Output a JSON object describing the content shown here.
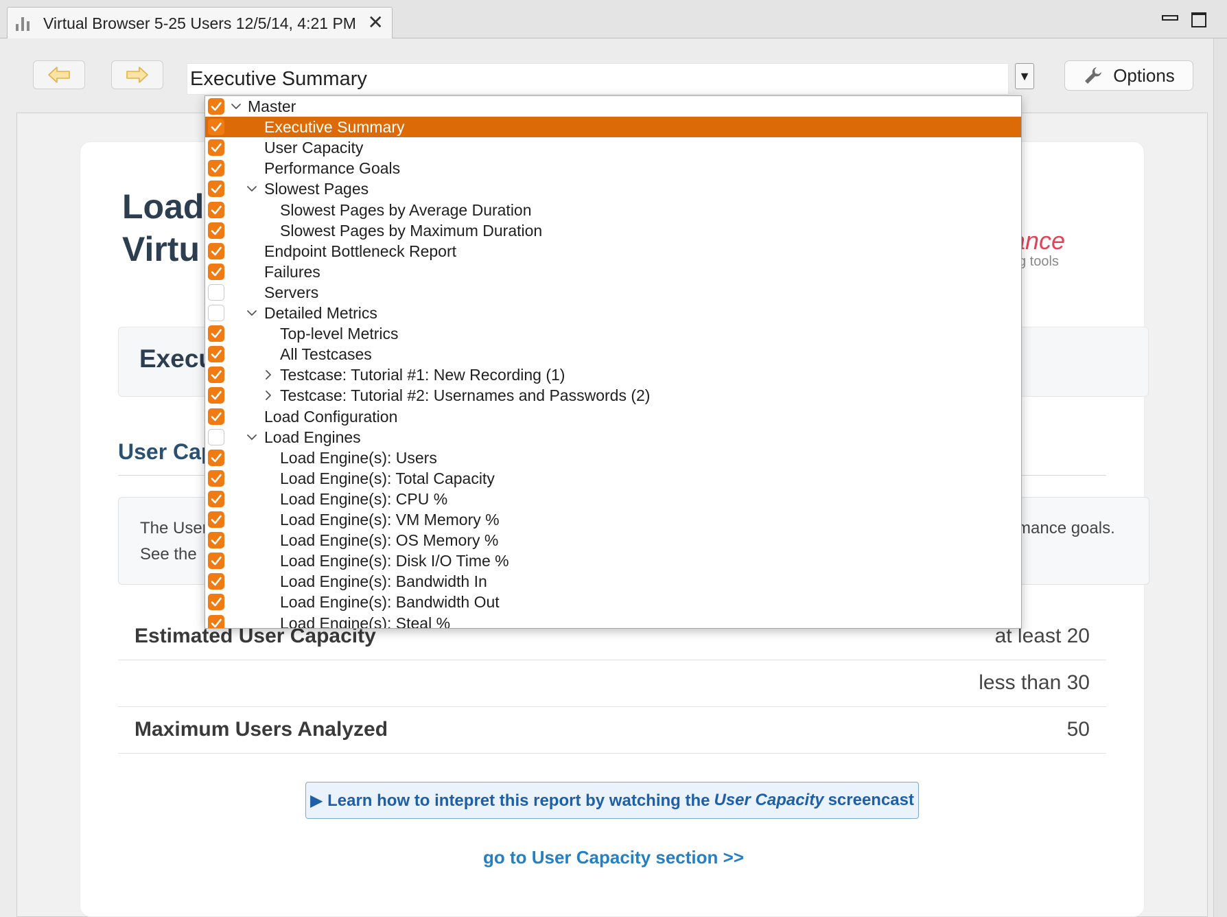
{
  "tab": {
    "title": "Virtual Browser 5-25 Users 12/5/14, 4:21 PM",
    "close_symbol": "✕",
    "icon": "bar-chart-icon"
  },
  "toolbar": {
    "back_icon": "back-arrow-icon",
    "forward_icon": "forward-arrow-icon",
    "report_select": "Executive Summary",
    "dropdown_symbol": "▼",
    "options_label": "Options",
    "options_icon": "wrench-icon"
  },
  "report": {
    "title_line1": "Load",
    "title_line2": "Virtu",
    "brand_partial": "ance",
    "brand_sub_partial": "g tools",
    "section_header": "Execu",
    "subsection_title": "User Cap",
    "info_line1_left": "The User",
    "info_line2_left": "See the",
    "info_line1_right": "mance goals.",
    "table": [
      {
        "label": "Estimated User Capacity",
        "value": "at least 20"
      },
      {
        "label": "",
        "value": "less than 30"
      },
      {
        "label": "Maximum Users Analyzed",
        "value": "50"
      }
    ],
    "learn_prefix": "▶ Learn how to intepret this report by watching the",
    "learn_emph": "User Capacity",
    "learn_suffix": "screencast",
    "goto_link": "go to User Capacity section >>"
  },
  "colors": {
    "accent_orange": "#f07b12",
    "selected_row": "#dc6b07",
    "heading": "#2c3e50",
    "link": "#2480c3"
  },
  "dropdown": {
    "items": [
      {
        "label": "Master",
        "level": 0,
        "checked": true,
        "expander": "expanded",
        "selected": false
      },
      {
        "label": "Executive Summary",
        "level": 1,
        "checked": true,
        "expander": "none",
        "selected": true
      },
      {
        "label": "User Capacity",
        "level": 1,
        "checked": true,
        "expander": "none",
        "selected": false
      },
      {
        "label": "Performance Goals",
        "level": 1,
        "checked": true,
        "expander": "none",
        "selected": false
      },
      {
        "label": "Slowest Pages",
        "level": 1,
        "checked": true,
        "expander": "expanded",
        "selected": false
      },
      {
        "label": "Slowest Pages by Average Duration",
        "level": 2,
        "checked": true,
        "expander": "none",
        "selected": false
      },
      {
        "label": "Slowest Pages by Maximum Duration",
        "level": 2,
        "checked": true,
        "expander": "none",
        "selected": false
      },
      {
        "label": "Endpoint Bottleneck Report",
        "level": 1,
        "checked": true,
        "expander": "none",
        "selected": false
      },
      {
        "label": "Failures",
        "level": 1,
        "checked": true,
        "expander": "none",
        "selected": false
      },
      {
        "label": "Servers",
        "level": 1,
        "checked": false,
        "expander": "none",
        "selected": false
      },
      {
        "label": "Detailed Metrics",
        "level": 1,
        "checked": false,
        "expander": "expanded",
        "selected": false
      },
      {
        "label": "Top-level Metrics",
        "level": 2,
        "checked": true,
        "expander": "none",
        "selected": false
      },
      {
        "label": "All Testcases",
        "level": 2,
        "checked": true,
        "expander": "none",
        "selected": false
      },
      {
        "label": "Testcase: Tutorial #1: New Recording (1)",
        "level": 2,
        "checked": true,
        "expander": "collapsed",
        "selected": false
      },
      {
        "label": "Testcase: Tutorial #2: Usernames and Passwords (2)",
        "level": 2,
        "checked": true,
        "expander": "collapsed",
        "selected": false
      },
      {
        "label": "Load Configuration",
        "level": 1,
        "checked": true,
        "expander": "none",
        "selected": false
      },
      {
        "label": "Load Engines",
        "level": 1,
        "checked": false,
        "expander": "expanded",
        "selected": false
      },
      {
        "label": "Load Engine(s): Users",
        "level": 2,
        "checked": true,
        "expander": "none",
        "selected": false
      },
      {
        "label": "Load Engine(s): Total Capacity",
        "level": 2,
        "checked": true,
        "expander": "none",
        "selected": false
      },
      {
        "label": "Load Engine(s): CPU %",
        "level": 2,
        "checked": true,
        "expander": "none",
        "selected": false
      },
      {
        "label": "Load Engine(s): VM Memory %",
        "level": 2,
        "checked": true,
        "expander": "none",
        "selected": false
      },
      {
        "label": "Load Engine(s): OS Memory %",
        "level": 2,
        "checked": true,
        "expander": "none",
        "selected": false
      },
      {
        "label": "Load Engine(s): Disk I/O Time %",
        "level": 2,
        "checked": true,
        "expander": "none",
        "selected": false
      },
      {
        "label": "Load Engine(s): Bandwidth In",
        "level": 2,
        "checked": true,
        "expander": "none",
        "selected": false
      },
      {
        "label": "Load Engine(s): Bandwidth Out",
        "level": 2,
        "checked": true,
        "expander": "none",
        "selected": false
      },
      {
        "label": "Load Engine(s): Steal %",
        "level": 2,
        "checked": true,
        "expander": "none",
        "selected": false
      }
    ]
  }
}
